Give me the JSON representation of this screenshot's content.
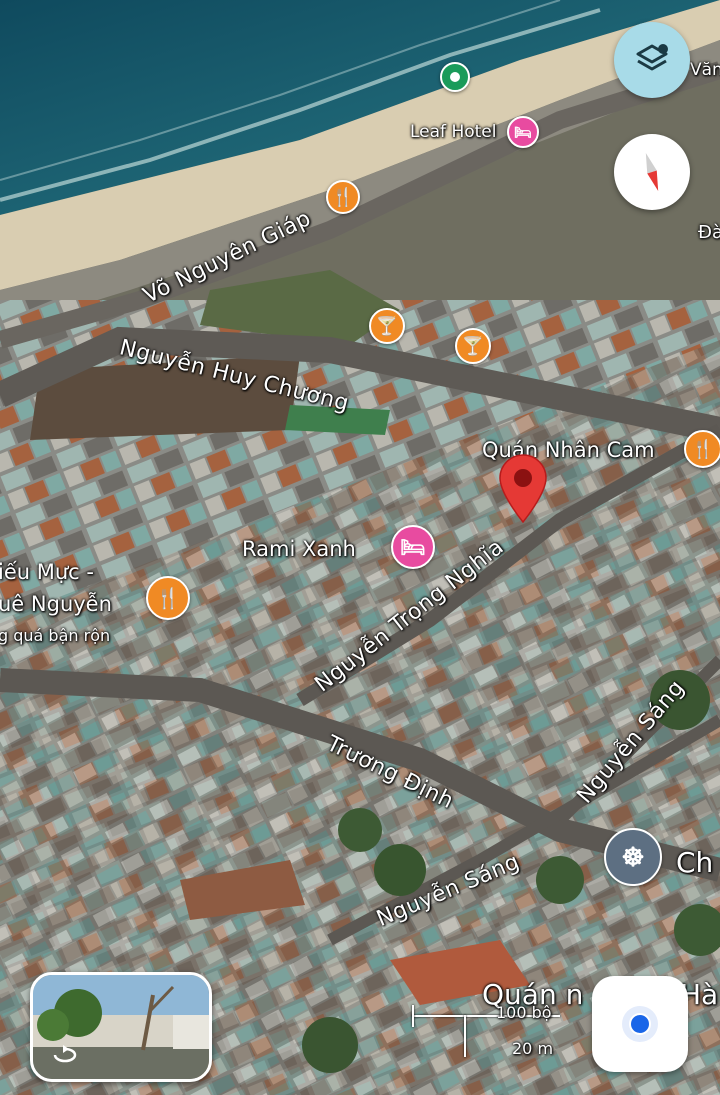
{
  "roads": {
    "vo_nguyen_giap": "Võ Nguyên Giáp",
    "nguyen_huy_chuong": "Nguyễn Huy Chương",
    "nguyen_trong_nghia": "Nguyễn Trọng Nghĩa",
    "truong_dinh": "Trương Định",
    "nguyen_sang_1": "Nguyễn Sáng",
    "nguyen_sang_2": "Nguyễn Sáng"
  },
  "places": {
    "leaf_hotel": "Leaf Hotel",
    "quan_nhan_cam": "Quán Nhân Cam",
    "rami_xanh": "Rami Xanh",
    "left_place_line1": "iếu Mực -",
    "left_place_line2": "uê Nguyễn",
    "left_place_line3": "g quá bận rộn",
    "right_edge_1": "Văn",
    "right_edge_2": "Đà",
    "right_edge_3": "Ch",
    "bottom_place": "Quán n",
    "bottom_place_tail": "Hà"
  },
  "scale": {
    "feet": "100 bộ",
    "meters": "20 m"
  },
  "icons": {
    "layers": "layers-icon",
    "compass": "compass-icon",
    "location": "my-location-icon",
    "street_view": "street-view-rotate-icon"
  },
  "colors": {
    "pin_red": "#e53935",
    "food_orange": "#f08a24",
    "hotel_pink": "#e84ba0",
    "layers_button": "#a8dbe8",
    "location_blue": "#1a66e8"
  }
}
